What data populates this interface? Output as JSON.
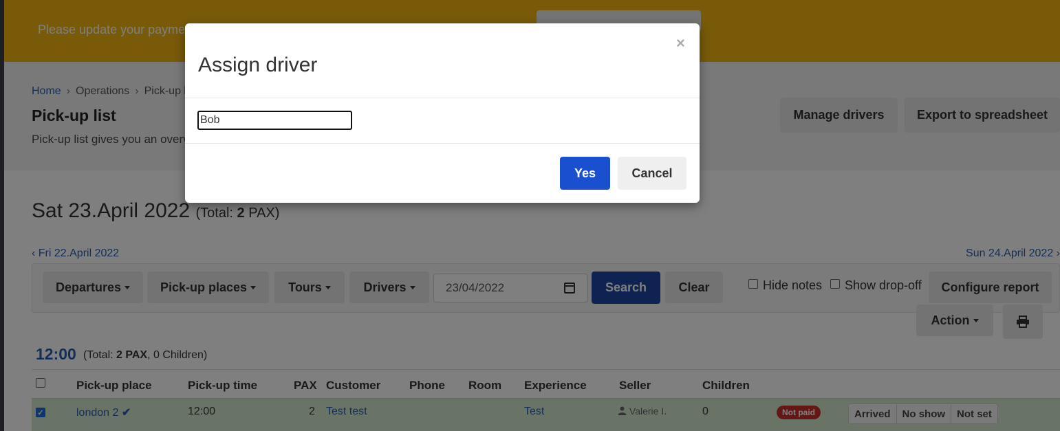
{
  "banner": {
    "text": "Please update your payment"
  },
  "breadcrumb": {
    "home": "Home",
    "operations": "Operations",
    "current": "Pick-up list",
    "separator": "›"
  },
  "page": {
    "title": "Pick-up list",
    "description": "Pick-up list gives you an overview"
  },
  "header_buttons": {
    "manage_drivers": "Manage drivers",
    "export": "Export to spreadsheet"
  },
  "date_header": {
    "date": "Sat 23.April 2022",
    "total_prefix": "(Total: ",
    "total_value": "2",
    "total_suffix": " PAX)"
  },
  "nav": {
    "prev": "‹ Fri 22.April 2022",
    "next": "Sun 24.April 2022 ›"
  },
  "filters": {
    "departures": "Departures",
    "pickup_places": "Pick-up places",
    "tours": "Tours",
    "drivers": "Drivers",
    "date_value": "23/04/2022",
    "search": "Search",
    "clear": "Clear",
    "hide_notes": "Hide notes",
    "show_dropoff": "Show drop-off",
    "configure_report": "Configure report",
    "action": "Action"
  },
  "group": {
    "time": "12:00",
    "total_prefix": "(Total: ",
    "total_pax": "2 PAX",
    "total_suffix": ", 0 Children)"
  },
  "table": {
    "headers": [
      "Pick-up place",
      "Pick-up time",
      "PAX",
      "Customer",
      "Phone",
      "Room",
      "Experience",
      "Seller",
      "Children"
    ],
    "rows": [
      {
        "pickup_place": "london 2",
        "pickup_time": "12:00",
        "pax": "2",
        "customer": "Test test",
        "phone": "",
        "room": "",
        "experience": "Test",
        "seller": "Valerie I.",
        "children": "0",
        "payment_status": "Not paid",
        "actions": [
          "Arrived",
          "No show",
          "Not set"
        ]
      }
    ]
  },
  "modal": {
    "title": "Assign driver",
    "close": "×",
    "input_value": "Bob",
    "yes": "Yes",
    "cancel": "Cancel"
  }
}
